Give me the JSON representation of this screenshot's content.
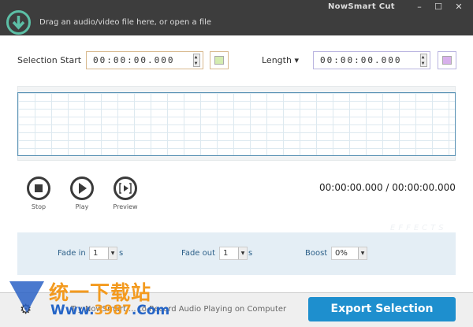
{
  "titlebar": {
    "app_name": "NowSmart Cut",
    "drop_text": "Drag an audio/video file here, or open a file",
    "minimize": "–",
    "maximize": "☐",
    "close": "✕"
  },
  "selection": {
    "start_label": "Selection Start",
    "start_value": "00:00:00.000",
    "length_label": "Length ▾",
    "length_value": "00:00:00.000",
    "start_color": "#d4ecb0",
    "length_color": "#d8b0ec"
  },
  "controls": {
    "stop": "Stop",
    "play": "Play",
    "preview": "Preview",
    "timer": "00:00:00.000 / 00:00:00.000"
  },
  "effects": {
    "watermark": "EFFECTS",
    "fade_in_label": "Fade in",
    "fade_in_value": "1",
    "fade_in_unit": "s",
    "fade_out_label": "Fade out",
    "fade_out_value": "1",
    "fade_out_unit": "s",
    "boost_label": "Boost",
    "boost_value": "0%"
  },
  "footer": {
    "tip": "Try NowSmart ... to Record Audio Playing on Computer",
    "export": "Export Selection"
  },
  "watermark": {
    "cn": "统一下载站",
    "url_a": "Www.",
    "url_b": "3987",
    "url_c": ".Com"
  }
}
